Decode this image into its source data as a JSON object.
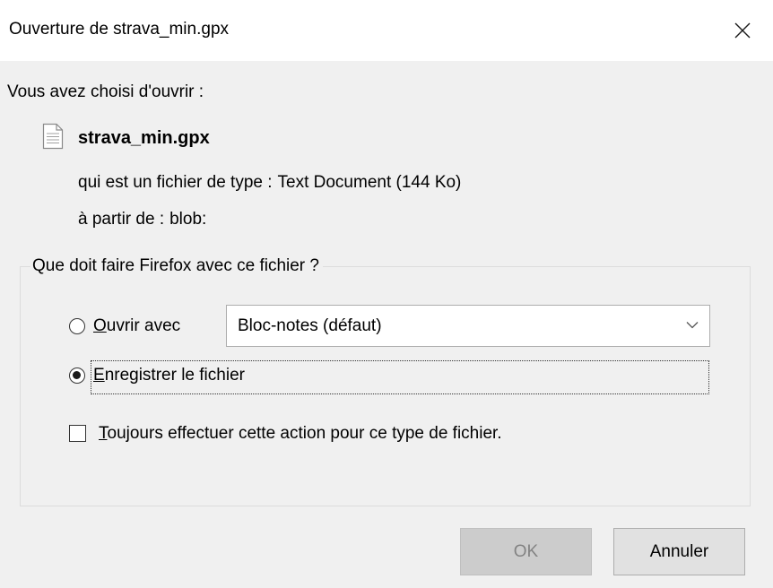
{
  "window": {
    "title": "Ouverture de strava_min.gpx"
  },
  "intro": "Vous avez choisi d'ouvrir :",
  "file": {
    "name": "strava_min.gpx",
    "icon": "document-icon",
    "type_label": "qui est un fichier de type :",
    "type_value": "Text Document (144 Ko)",
    "source_label": "à partir de :",
    "source_value": "blob:"
  },
  "action_group": {
    "legend": "Que doit faire Firefox avec ce fichier ?",
    "open_with": {
      "accel": "O",
      "rest": "uvrir avec",
      "selected": false,
      "app_value": "Bloc-notes (défaut)"
    },
    "save_file": {
      "accel": "E",
      "rest": "nregistrer le fichier",
      "selected": true
    },
    "always": {
      "accel": "T",
      "rest": "oujours effectuer cette action pour ce type de fichier.",
      "checked": false
    }
  },
  "buttons": {
    "ok": "OK",
    "cancel": "Annuler"
  },
  "colors": {
    "dialog_bg": "#f0f0f0",
    "titlebar_bg": "#ffffff",
    "disabled_button_bg": "#cccccc",
    "button_bg": "#e1e1e1"
  }
}
